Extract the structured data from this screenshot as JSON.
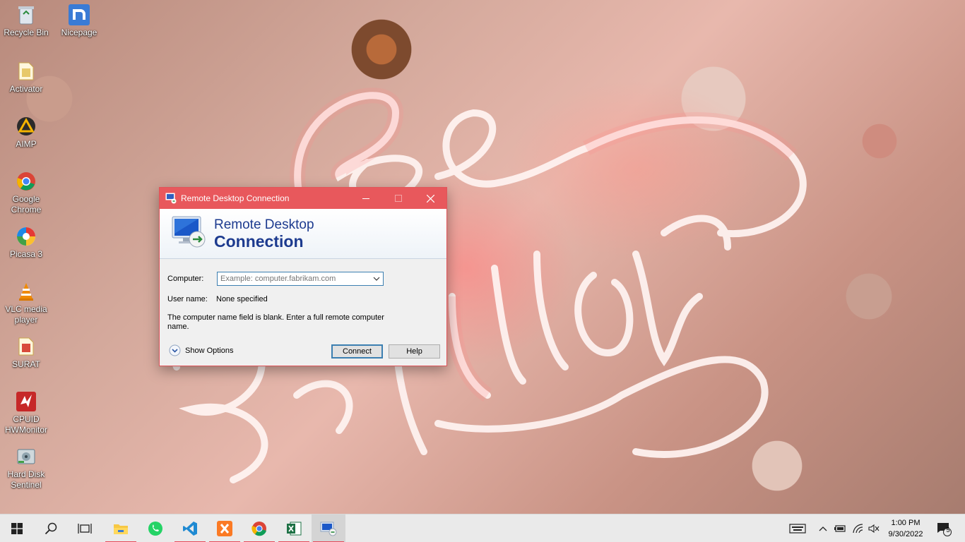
{
  "desktop": {
    "icons": [
      {
        "label": "Recycle Bin",
        "icon": "recycle-bin-icon"
      },
      {
        "label": "Nicepage",
        "icon": "nicepage-icon"
      },
      {
        "label": "Activator",
        "icon": "file-icon"
      },
      {
        "label": "AIMP",
        "icon": "aimp-icon"
      },
      {
        "label": "Google Chrome",
        "icon": "chrome-icon"
      },
      {
        "label": "Picasa 3",
        "icon": "picasa-icon"
      },
      {
        "label": "VLC media player",
        "icon": "vlc-icon"
      },
      {
        "label": "SURAT",
        "icon": "file-icon"
      },
      {
        "label": "CPUID HWMonitor",
        "icon": "hwmonitor-icon"
      },
      {
        "label": "Hard Disk Sentinel",
        "icon": "hdsentinel-icon"
      }
    ]
  },
  "window": {
    "title": "Remote Desktop Connection",
    "banner_line1": "Remote Desktop",
    "banner_line2": "Connection",
    "computer_label": "Computer:",
    "computer_placeholder": "Example: computer.fabrikam.com",
    "computer_value": "",
    "username_label": "User name:",
    "username_value": "None specified",
    "message": "The computer name field is blank. Enter a full remote computer name.",
    "show_options": "Show Options",
    "connect_label": "Connect",
    "help_label": "Help"
  },
  "taskbar": {
    "apps": [
      "start",
      "search",
      "task-view",
      "file-explorer",
      "whatsapp",
      "vscode",
      "xampp",
      "chrome",
      "excel",
      "remote-desktop"
    ],
    "clock_time": "1:00 PM",
    "clock_date": "9/30/2022",
    "notification_count": "5"
  },
  "colors": {
    "titlebar": "#e8585c",
    "accent_blue": "#1d3b8f",
    "taskbar_bg": "#eaeaea"
  }
}
